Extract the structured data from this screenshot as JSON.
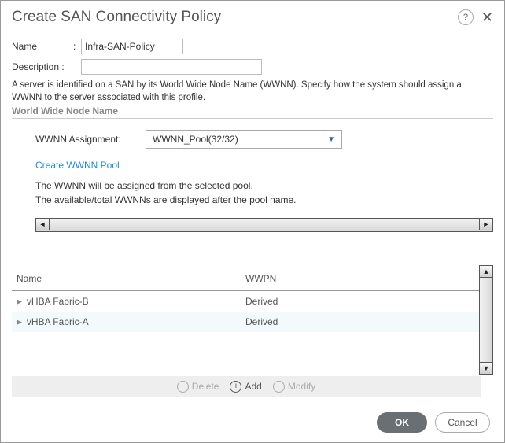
{
  "dialog": {
    "title": "Create SAN Connectivity Policy",
    "help": "?",
    "close": "✕"
  },
  "fields": {
    "name_label": "Name",
    "name_value": "Infra-SAN-Policy",
    "desc_label": "Description :",
    "desc_value": ""
  },
  "info_text": "A server is identified on a SAN by its World Wide Node Name (WWNN). Specify how the system should assign a WWNN to the server associated with this profile.",
  "section_header": "World Wide Node Name",
  "wwnn": {
    "label": "WWNN Assignment:",
    "selected": "WWNN_Pool(32/32)",
    "create_link": "Create WWNN Pool",
    "note1": "The WWNN will be assigned from the selected pool.",
    "note2": "The available/total WWNNs are displayed after the pool name."
  },
  "table": {
    "headers": {
      "name": "Name",
      "wwpn": "WWPN"
    },
    "rows": [
      {
        "name": "vHBA Fabric-B",
        "wwpn": "Derived"
      },
      {
        "name": "vHBA Fabric-A",
        "wwpn": "Derived"
      }
    ]
  },
  "actions": {
    "delete": "Delete",
    "add": "Add",
    "modify": "Modify"
  },
  "buttons": {
    "ok": "OK",
    "cancel": "Cancel"
  }
}
